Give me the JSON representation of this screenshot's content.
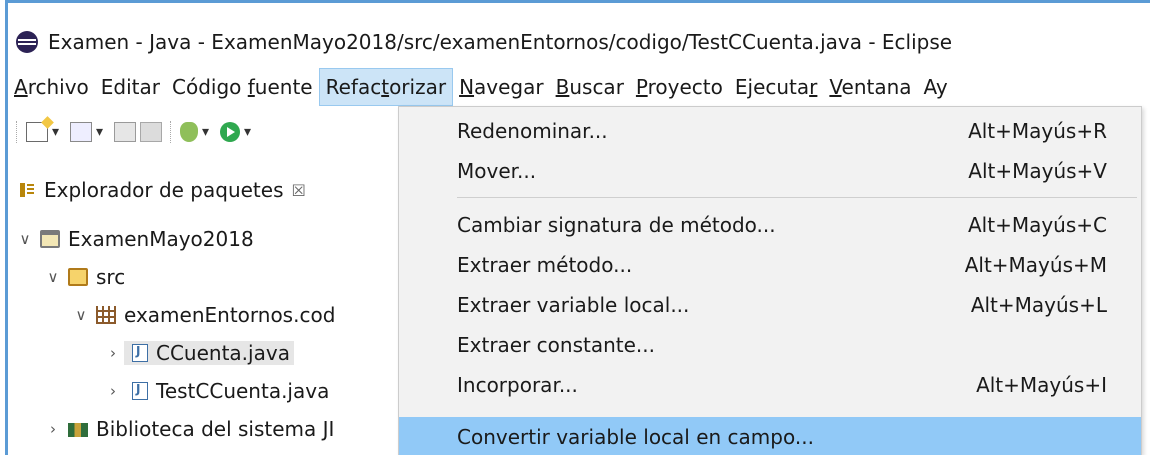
{
  "window": {
    "title": "Examen - Java - ExamenMayo2018/src/examenEntornos/codigo/TestCCuenta.java - Eclipse"
  },
  "menubar": [
    {
      "pre": "",
      "u": "A",
      "post": "rchivo",
      "active": false
    },
    {
      "pre": "Editar",
      "u": "",
      "post": "",
      "active": false
    },
    {
      "pre": "Código ",
      "u": "f",
      "post": "uente",
      "active": false
    },
    {
      "pre": "Refac",
      "u": "t",
      "post": "orizar",
      "active": true
    },
    {
      "pre": "",
      "u": "N",
      "post": "avegar",
      "active": false
    },
    {
      "pre": "",
      "u": "B",
      "post": "uscar",
      "active": false
    },
    {
      "pre": "",
      "u": "P",
      "post": "royecto",
      "active": false
    },
    {
      "pre": "Ejecuta",
      "u": "r",
      "post": "",
      "active": false
    },
    {
      "pre": "",
      "u": "V",
      "post": "entana",
      "active": false
    },
    {
      "pre": "Ay",
      "u": "",
      "post": "",
      "active": false
    }
  ],
  "explorer": {
    "tab_label": "Explorador de paquetes",
    "close_glyph": "☒",
    "tree": {
      "project": "ExamenMayo2018",
      "src": "src",
      "package": "examenEntornos.cod",
      "file1": "CCuenta.java",
      "file2": "TestCCuenta.java",
      "library": "Biblioteca del sistema JI"
    }
  },
  "refactor_menu": {
    "items": [
      {
        "label": "Redenominar...",
        "accel": "Alt+Mayús+R"
      },
      {
        "label": "Mover...",
        "accel": "Alt+Mayús+V"
      },
      {
        "label": "Cambiar signatura de método...",
        "accel": "Alt+Mayús+C"
      },
      {
        "label": "Extraer método...",
        "accel": "Alt+Mayús+M"
      },
      {
        "label": "Extraer variable local...",
        "accel": "Alt+Mayús+L"
      },
      {
        "label": "Extraer constante...",
        "accel": ""
      },
      {
        "label": "Incorporar...",
        "accel": "Alt+Mayús+I"
      },
      {
        "label": "Convertir variable local en campo...",
        "accel": ""
      }
    ],
    "highlighted_index": 7
  },
  "colors": {
    "menu_active": "#cce4f7",
    "menu_highlight": "#91c9f7",
    "frame_border": "#5b9bd5"
  }
}
